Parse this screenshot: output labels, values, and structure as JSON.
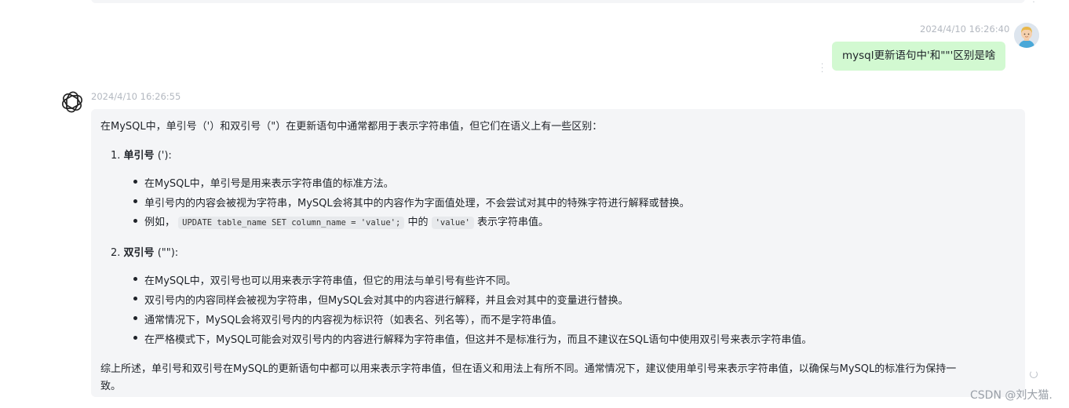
{
  "previous_message": {},
  "user_message": {
    "timestamp": "2024/4/10 16:26:40",
    "text": "mysql更新语句中'和\"\"'区别是啥",
    "avatar_icon": "user-avatar-icon"
  },
  "ai_message": {
    "timestamp": "2024/4/10 16:26:55",
    "icon": "openai-logo-icon",
    "intro": "在MySQL中，单引号（'）和双引号（\"）在更新语句中通常都用于表示字符串值，但它们在语义上有一些区别：",
    "sections": [
      {
        "number": "1.",
        "title": "单引号",
        "title_suffix": " ('):",
        "bullets": [
          "在MySQL中，单引号是用来表示字符串值的标准方法。",
          "单引号内的内容会被视为字符串，MySQL会将其中的内容作为字面值处理，不会尝试对其中的特殊字符进行解释或替换。"
        ],
        "example": {
          "prefix": "例如，",
          "code1": "UPDATE table_name SET column_name = 'value';",
          "middle": "中的",
          "code2": "'value'",
          "suffix": "表示字符串值。"
        }
      },
      {
        "number": "2.",
        "title": "双引号",
        "title_suffix": " (\"\"):",
        "bullets": [
          "在MySQL中，双引号也可以用来表示字符串值，但它的用法与单引号有些许不同。",
          "双引号内的内容同样会被视为字符串，但MySQL会对其中的内容进行解释，并且会对其中的变量进行替换。",
          "通常情况下，MySQL会将双引号内的内容视为标识符（如表名、列名等），而不是字符串值。",
          "在严格模式下，MySQL可能会对双引号内的内容进行解释为字符串值，但这并不是标准行为，而且不建议在SQL语句中使用双引号来表示字符串值。"
        ]
      }
    ],
    "conclusion_line1": "综上所述，单引号和双引号在MySQL的更新语句中都可以用来表示字符串值，但在语义和用法上有所不同。通常情况下，建议使用单引号来表示字符串值，以确保与MySQL的标准行为保持一",
    "conclusion_line2": "致。"
  },
  "watermark": "CSDN @刘大猫."
}
